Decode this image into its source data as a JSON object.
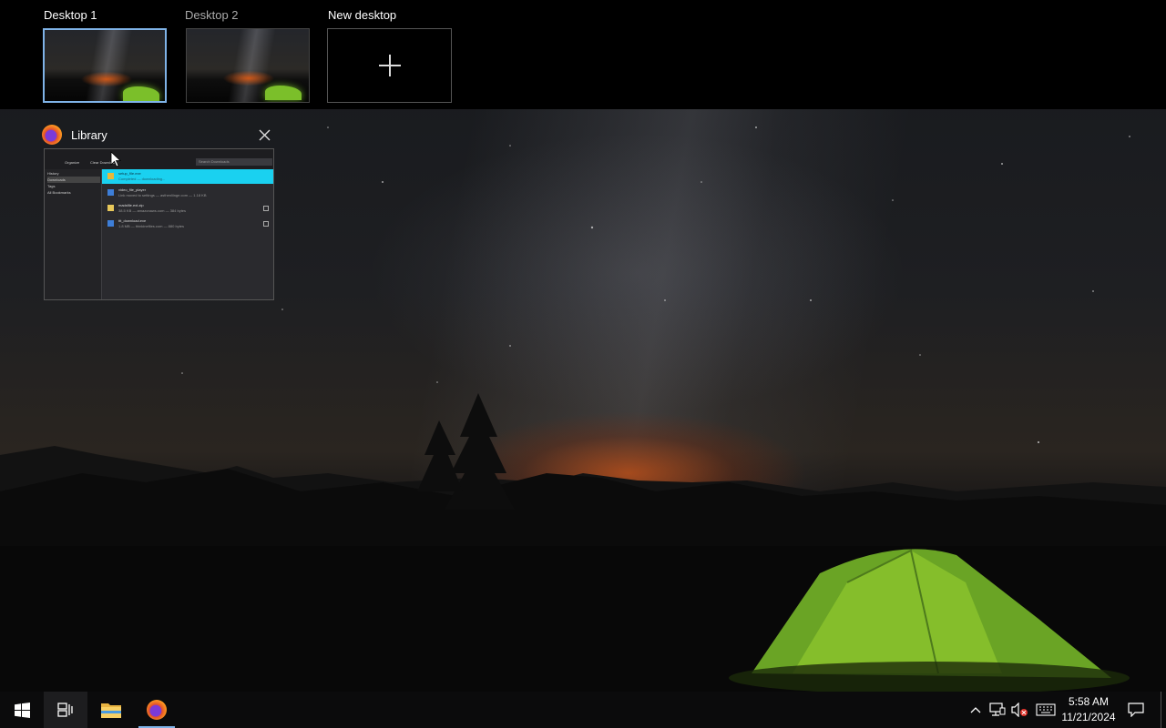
{
  "desktops": [
    {
      "label": "Desktop 1",
      "active": true
    },
    {
      "label": "Desktop 2",
      "active": false
    }
  ],
  "new_desktop": {
    "label": "New desktop",
    "icon": "plus-icon"
  },
  "window": {
    "title": "Library",
    "app_icon": "firefox-icon",
    "close_icon": "close-icon",
    "thumbnail": {
      "toolbar_items": [
        "Organize",
        "Clear Downloads"
      ],
      "search_placeholder": "Search Downloads",
      "sidebar_items": [
        "History",
        "Downloads",
        "Tags",
        "All Bookmarks"
      ],
      "downloads": [
        {
          "name": "setup_file.exe",
          "detail": "Completed — downloading...",
          "selected": true
        },
        {
          "name": "video_file_player",
          "detail": "Link moved to settings — asthenliinge.com — 1.18 KB",
          "selected": false
        },
        {
          "name": "madsfile.ext.zip",
          "detail": "38.5 KB — amazonaws.com — 384 bytes",
          "selected": false
        },
        {
          "name": "ttt_download.exe",
          "detail": "1.8 MB — thinkinefiles.com — 880 bytes",
          "selected": false
        }
      ]
    }
  },
  "taskbar": {
    "start_icon": "windows-start-icon",
    "task_view_icon": "task-view-icon",
    "file_explorer_icon": "file-explorer-icon",
    "firefox_icon": "firefox-icon",
    "tray": {
      "chevron_icon": "chevron-up-icon",
      "network_icon": "network-icon",
      "volume_icon": "volume-muted-icon",
      "keyboard_icon": "keyboard-icon",
      "notification_icon": "notification-icon"
    },
    "time": "5:58 AM",
    "date": "11/21/2024"
  },
  "colors": {
    "accent": "#7fb3e8",
    "selection": "#1ad1f0",
    "tent": "#7bbf2a"
  }
}
